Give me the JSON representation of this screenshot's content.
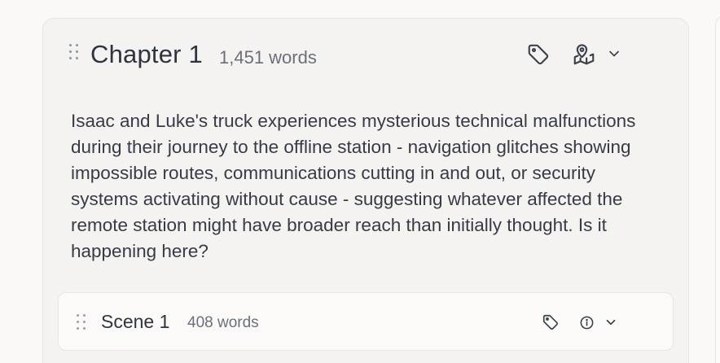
{
  "chapter": {
    "title": "Chapter 1",
    "word_count": "1,451 words",
    "summary": "Isaac and Luke's truck experiences mysterious technical malfunctions during their journey to the offline station - navigation glitches showing impossible routes, communications cutting in and out, or security systems activating without cause - suggesting whatever affected the remote station might have broader reach than initially thought. Is it happening here?",
    "icons": {
      "drag": "drag-handle-icon",
      "tag": "tag-icon",
      "map": "map-pin-icon",
      "expand": "chevron-down-icon"
    }
  },
  "scene": {
    "title": "Scene 1",
    "word_count": "408 words",
    "icons": {
      "drag": "drag-handle-icon",
      "tag": "tag-icon",
      "info": "info-icon",
      "expand": "chevron-down-icon"
    }
  },
  "colors": {
    "text": "#2f3540",
    "muted": "#6a707a",
    "card_bg": "#f4f3f2",
    "scene_bg": "#fbfaf9",
    "border": "#e7e5e2"
  }
}
